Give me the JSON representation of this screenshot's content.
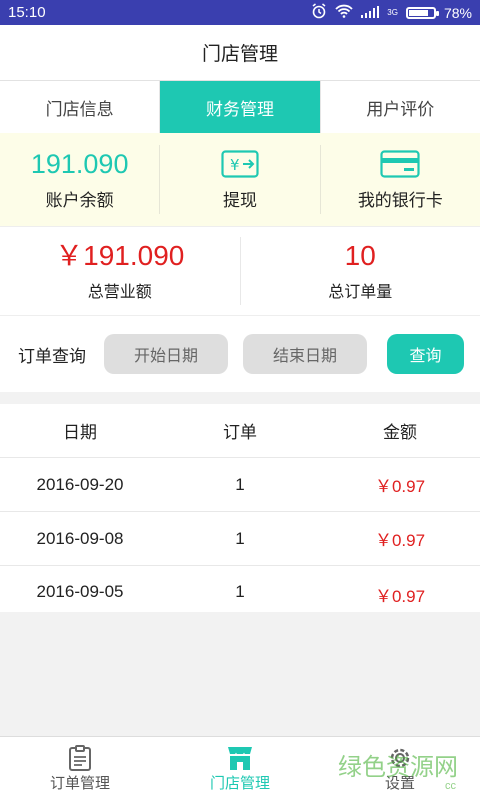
{
  "status": {
    "time": "15:10",
    "network": "3G",
    "battery": "78%",
    "battery_level": 0.78
  },
  "header": {
    "title": "门店管理"
  },
  "tabs": [
    {
      "label": "门店信息",
      "active": false
    },
    {
      "label": "财务管理",
      "active": true
    },
    {
      "label": "用户评价",
      "active": false
    }
  ],
  "summary": {
    "balance_value": "191.090",
    "balance_label": "账户余额",
    "withdraw_label": "提现",
    "withdraw_icon_text": "¥",
    "bankcard_label": "我的银行卡"
  },
  "stats": {
    "revenue_value": "￥191.090",
    "revenue_label": "总营业额",
    "orders_value": "10",
    "orders_label": "总订单量"
  },
  "query": {
    "label": "订单查询",
    "start_date": "开始日期",
    "end_date": "结束日期",
    "submit": "查询"
  },
  "table": {
    "headers": [
      "日期",
      "订单",
      "金额"
    ],
    "rows": [
      {
        "date": "2016-09-20",
        "orders": "1",
        "amount": "￥0.97"
      },
      {
        "date": "2016-09-08",
        "orders": "1",
        "amount": "￥0.97"
      },
      {
        "date": "2016-09-05",
        "orders": "1",
        "amount": "￥0.97"
      }
    ]
  },
  "bottom_nav": [
    {
      "label": "订单管理",
      "icon": "clipboard-icon",
      "active": false
    },
    {
      "label": "门店管理",
      "icon": "store-icon",
      "active": true
    },
    {
      "label": "设置",
      "icon": "gear-icon",
      "active": false
    }
  ],
  "watermark": {
    "text": "绿色资源网",
    "url": "cc"
  },
  "colors": {
    "accent": "#1ec8b2",
    "price": "#e02020",
    "statusbar": "#3a3faf",
    "summary_bg": "#fdfde8"
  }
}
